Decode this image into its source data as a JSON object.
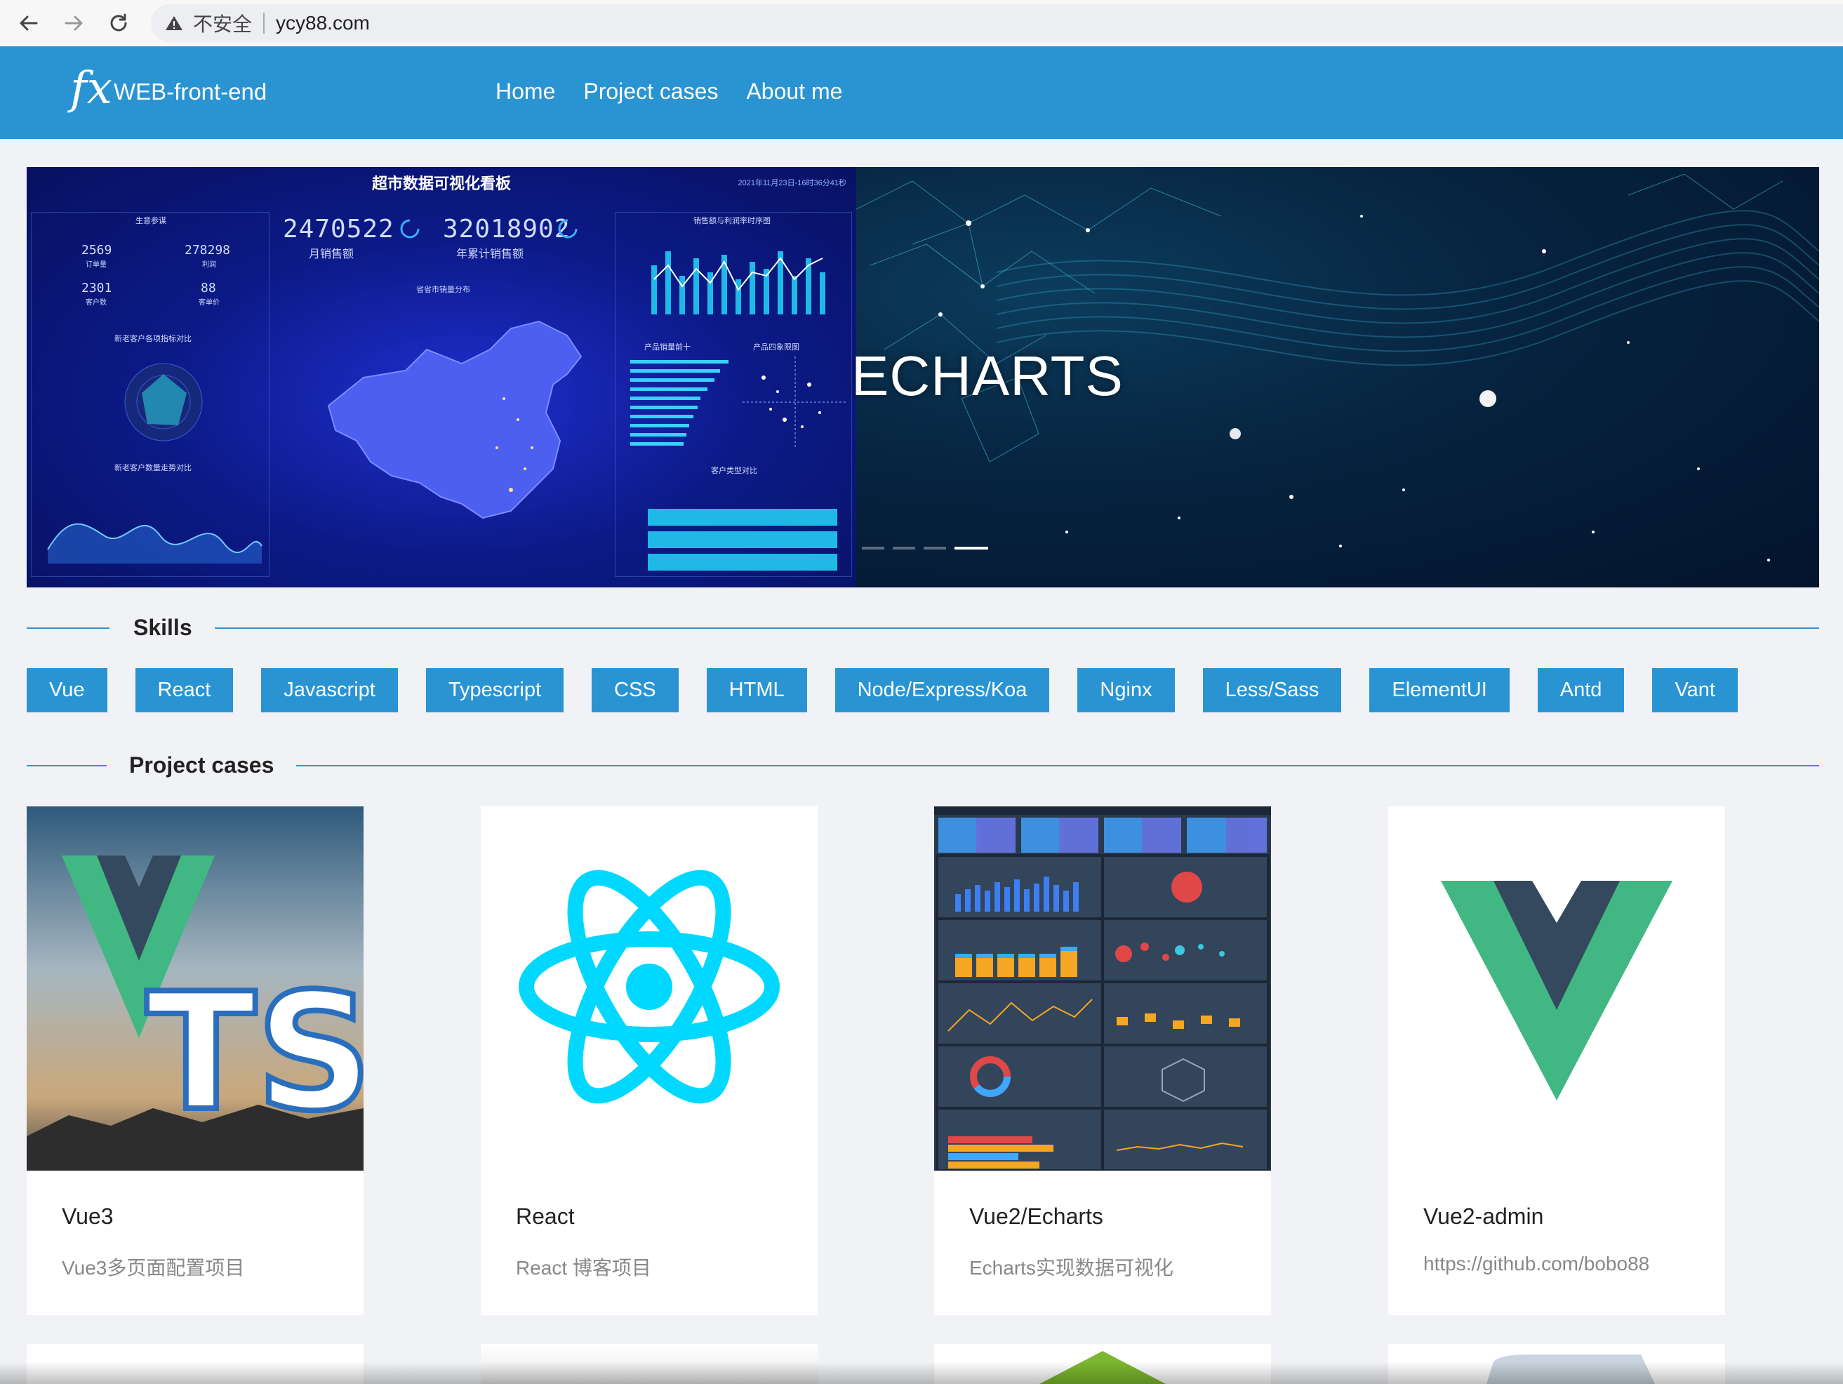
{
  "browser": {
    "security_label": "不安全",
    "url": "ycy88.com"
  },
  "header": {
    "logo_mark": "fx",
    "logo_text": "WEB-front-end",
    "nav": [
      "Home",
      "Project cases",
      "About me"
    ]
  },
  "carousel": {
    "dashboard_title": "超市数据可视化看板",
    "dashboard_stamp": "2021年11月23日-16时36分41秒",
    "kpis": [
      {
        "value": "2470522",
        "label": "月销售额"
      },
      {
        "value": "32018902",
        "label": "年累计销售额"
      }
    ],
    "small_stats": [
      {
        "value": "2569",
        "label": "订单量"
      },
      {
        "value": "278298",
        "label": "利润"
      },
      {
        "value": "2301",
        "label": "客户数"
      },
      {
        "value": "88",
        "label": "客单价"
      }
    ],
    "panel_labels": [
      "生意参谋",
      "销售额与利润率时序图",
      "省省市销量分布",
      "新老客户各项指标对比",
      "产品销量前十",
      "产品四象限图",
      "新老客户数量走势对比",
      "客户类型对比"
    ],
    "slide_caption": "ECHARTS",
    "slide_count": 4,
    "active_slide": 4
  },
  "skills_section": {
    "title": "Skills",
    "items": [
      "Vue",
      "React",
      "Javascript",
      "Typescript",
      "CSS",
      "HTML",
      "Node/Express/Koa",
      "Nginx",
      "Less/Sass",
      "ElementUI",
      "Antd",
      "Vant"
    ]
  },
  "projects_section": {
    "title": "Project cases",
    "cards": [
      {
        "title": "Vue3",
        "desc": "Vue3多页面配置项目",
        "thumb_text": "TS"
      },
      {
        "title": "React",
        "desc": "React 博客项目"
      },
      {
        "title": "Vue2/Echarts",
        "desc": "Echarts实现数据可视化"
      },
      {
        "title": "Vue2-admin",
        "desc": "https://github.com/bobo88"
      }
    ]
  },
  "colors": {
    "brand_blue": "#2a94d3",
    "vue_green": "#41b883",
    "vue_dark": "#34495e",
    "react_cyan": "#00d8ff"
  },
  "icons": [
    "back-arrow-icon",
    "forward-arrow-icon",
    "reload-icon",
    "warning-icon"
  ]
}
